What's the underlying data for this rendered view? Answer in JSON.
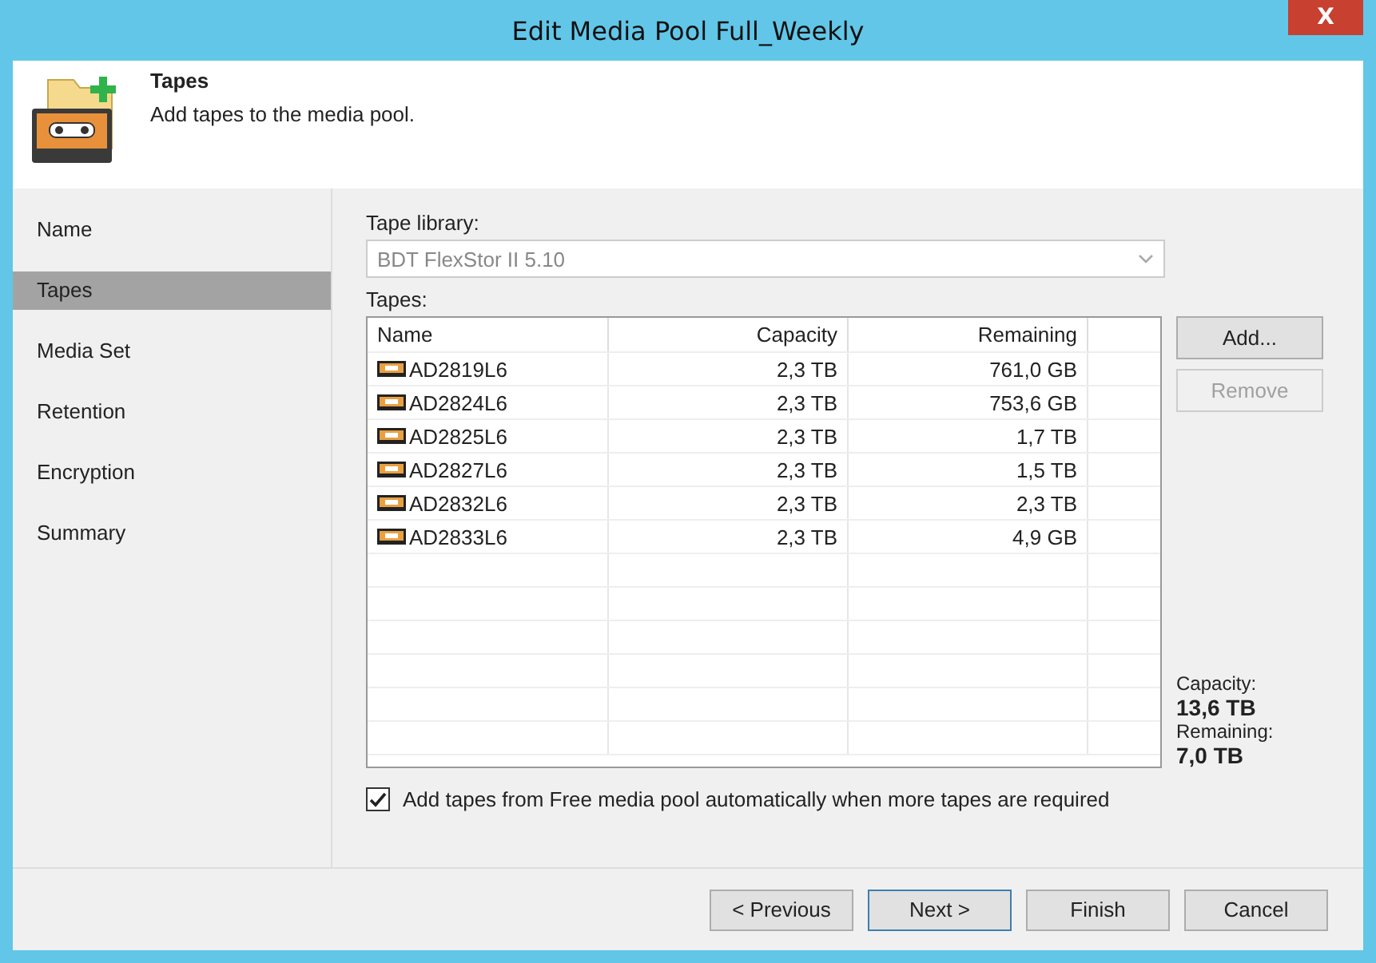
{
  "window": {
    "title": "Edit Media Pool Full_Weekly",
    "close": "X"
  },
  "header": {
    "title": "Tapes",
    "subtitle": "Add tapes to the media pool."
  },
  "steps": [
    {
      "label": "Name",
      "selected": false
    },
    {
      "label": "Tapes",
      "selected": true
    },
    {
      "label": "Media Set",
      "selected": false
    },
    {
      "label": "Retention",
      "selected": false
    },
    {
      "label": "Encryption",
      "selected": false
    },
    {
      "label": "Summary",
      "selected": false
    }
  ],
  "library": {
    "label": "Tape library:",
    "value": "BDT FlexStor II 5.10",
    "disabled": true
  },
  "tapes": {
    "label": "Tapes:",
    "columns": [
      "Name",
      "Capacity",
      "Remaining"
    ],
    "rows": [
      [
        "AD2819L6",
        "2,3 TB",
        "761,0 GB"
      ],
      [
        "AD2824L6",
        "2,3 TB",
        "753,6 GB"
      ],
      [
        "AD2825L6",
        "2,3 TB",
        "1,7 TB"
      ],
      [
        "AD2827L6",
        "2,3 TB",
        "1,5 TB"
      ],
      [
        "AD2832L6",
        "2,3 TB",
        "2,3 TB"
      ],
      [
        "AD2833L6",
        "2,3 TB",
        "4,9 GB"
      ]
    ]
  },
  "side_buttons": [
    {
      "label": "Add...",
      "disabled": false
    },
    {
      "label": "Remove",
      "disabled": true
    }
  ],
  "summary": [
    {
      "label": "Capacity:",
      "value": "13,6 TB"
    },
    {
      "label": "Remaining:",
      "value": "7,0 TB"
    }
  ],
  "auto_add": {
    "label": "Add tapes from Free media pool automatically when more tapes are required",
    "checked": true
  },
  "buttons": [
    {
      "label": "< Previous",
      "focused": false
    },
    {
      "label": "Next >",
      "focused": true
    },
    {
      "label": "Finish",
      "focused": false
    },
    {
      "label": "Cancel",
      "focused": false
    }
  ]
}
